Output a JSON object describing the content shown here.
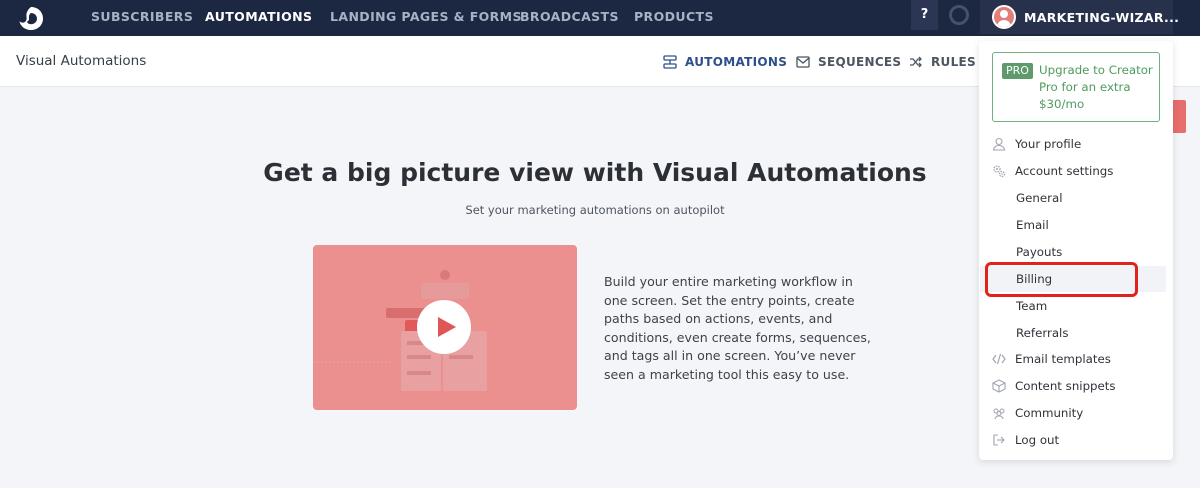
{
  "nav": {
    "items": [
      {
        "label": "SUBSCRIBERS"
      },
      {
        "label": "AUTOMATIONS"
      },
      {
        "label": "LANDING PAGES & FORMS"
      },
      {
        "label": "BROADCASTS"
      },
      {
        "label": "PRODUCTS"
      }
    ],
    "help_label": "?",
    "account_name": "MARKETING-WIZAR..."
  },
  "subheader": {
    "title": "Visual Automations",
    "tabs": [
      {
        "label": "AUTOMATIONS",
        "icon": "automation-icon"
      },
      {
        "label": "SEQUENCES",
        "icon": "envelope-icon"
      },
      {
        "label": "RULES",
        "icon": "shuffle-icon"
      }
    ]
  },
  "main": {
    "title": "Get a big picture view with Visual Automations",
    "subtitle": "Set your marketing automations on autopilot",
    "description": "Build your entire marketing workflow in one screen. Set the entry points, create paths based on actions, events, and conditions, even create forms, sequences, and tags all in one screen. You’ve never seen a marketing tool this easy to use."
  },
  "dropdown": {
    "upgrade": {
      "badge": "PRO",
      "text": "Upgrade to Creator Pro for an extra $30/mo"
    },
    "items": [
      {
        "label": "Your profile",
        "icon": "user-icon"
      },
      {
        "label": "Account settings",
        "icon": "gears-icon"
      },
      {
        "label": "General"
      },
      {
        "label": "Email"
      },
      {
        "label": "Payouts"
      },
      {
        "label": "Billing"
      },
      {
        "label": "Team"
      },
      {
        "label": "Referrals"
      },
      {
        "label": "Email templates",
        "icon": "code-icon"
      },
      {
        "label": "Content snippets",
        "icon": "cube-icon"
      },
      {
        "label": "Community",
        "icon": "people-icon"
      },
      {
        "label": "Log out",
        "icon": "logout-icon"
      }
    ]
  },
  "colors": {
    "nav_bg": "#1c2742",
    "accent_blue": "#2d4f8a",
    "upgrade_green": "#4d9b5f",
    "video_bg": "#ec8f8f",
    "highlight_red": "#e0231c"
  }
}
